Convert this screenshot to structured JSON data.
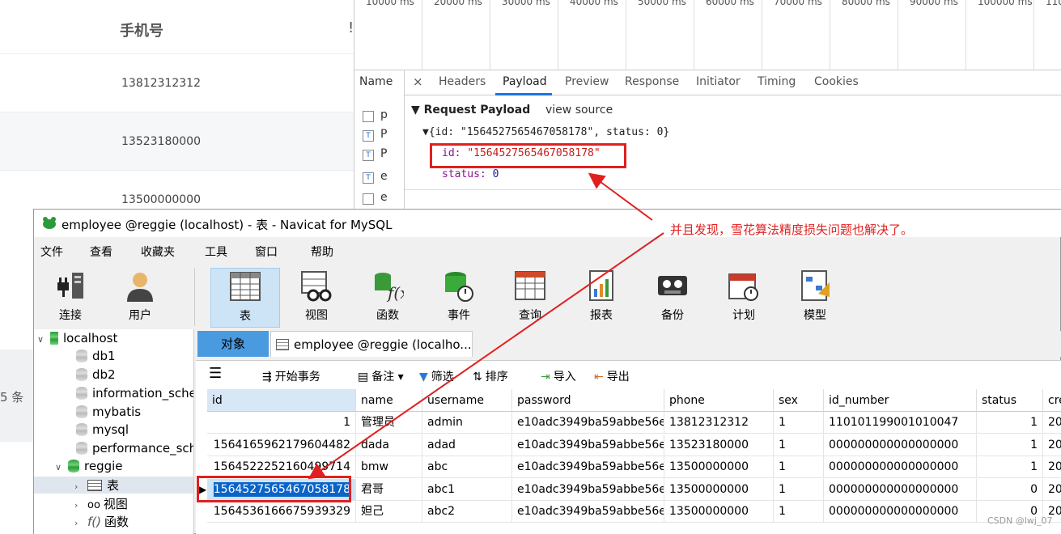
{
  "web": {
    "header": "手机号",
    "header_trunc": "!",
    "rows": [
      "13812312312",
      "13523180000",
      "13500000000"
    ],
    "tiao": "5 条"
  },
  "devtools": {
    "timeline": [
      "10000 ms",
      "20000 ms",
      "30000 ms",
      "40000 ms",
      "50000 ms",
      "60000 ms",
      "70000 ms",
      "80000 ms",
      "90000 ms",
      "100000 ms",
      "110"
    ],
    "name_header": "Name",
    "name_items": [
      "p",
      "P",
      "P",
      "e",
      "e"
    ],
    "close": "×",
    "tabs": [
      "Headers",
      "Payload",
      "Preview",
      "Response",
      "Initiator",
      "Timing",
      "Cookies"
    ],
    "payload": {
      "title": "▼ Request Payload",
      "view_source": "view source",
      "object_line": "▼{id: \"1564527565467058178\", status: 0}",
      "id_key": "id:",
      "id_value": "\"1564527565467058178\"",
      "status_key": "status:",
      "status_value": "0"
    }
  },
  "navicat": {
    "title": "employee @reggie (localhost) - 表 - Navicat for MySQL",
    "menu": [
      "文件",
      "查看",
      "收藏夹",
      "工具",
      "窗口",
      "帮助"
    ],
    "toolbar": [
      "连接",
      "用户",
      "表",
      "视图",
      "函数",
      "事件",
      "查询",
      "报表",
      "备份",
      "计划",
      "模型"
    ],
    "tree": {
      "host": "localhost",
      "dbs": [
        "db1",
        "db2",
        "information_sche",
        "mybatis",
        "mysql",
        "performance_sch",
        "reggie"
      ],
      "reggie_children": [
        "表",
        "视图",
        "函数"
      ]
    },
    "tabs": {
      "objects": "对象",
      "employee": "employee @reggie (localho..."
    },
    "subtoolbar": {
      "menu": "☰",
      "begin": "开始事务",
      "note": "备注",
      "filter": "筛选",
      "sort": "排序",
      "import": "导入",
      "export": "导出"
    },
    "columns": [
      "id",
      "name",
      "username",
      "password",
      "phone",
      "sex",
      "id_number",
      "status",
      "cre"
    ],
    "rows": [
      [
        "1",
        "管理员",
        "admin",
        "e10adc3949ba59abbe56e",
        "13812312312",
        "1",
        "110101199001010047",
        "1",
        "20"
      ],
      [
        "1564165962179604482",
        "dada",
        "adad",
        "e10adc3949ba59abbe56e",
        "13523180000",
        "1",
        "000000000000000000",
        "1",
        "20"
      ],
      [
        "1564522252160499714",
        "bmw",
        "abc",
        "e10adc3949ba59abbe56e",
        "13500000000",
        "1",
        "000000000000000000",
        "1",
        "20"
      ],
      [
        "1564527565467058178",
        "君哥",
        "abc1",
        "e10adc3949ba59abbe56e",
        "13500000000",
        "1",
        "000000000000000000",
        "0",
        "20"
      ],
      [
        "1564536166675939329",
        "妲己",
        "abc2",
        "e10adc3949ba59abbe56e",
        "13500000000",
        "1",
        "000000000000000000",
        "0",
        "20"
      ]
    ]
  },
  "annotation": "并且发现，雪花算法精度损失问题也解决了。",
  "watermark": "CSDN @lwj_07"
}
